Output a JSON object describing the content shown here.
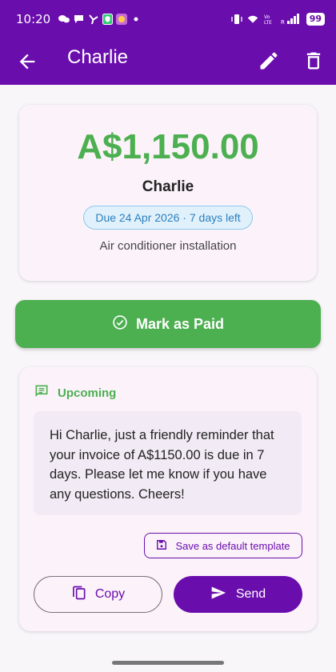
{
  "status_bar": {
    "time": "10:20",
    "battery": "99"
  },
  "app_bar": {
    "title": "Charlie"
  },
  "invoice": {
    "amount": "A$1,150.00",
    "client_name": "Charlie",
    "due_text": "Due 24 Apr 2026 · 7 days left",
    "description": "Air conditioner installation"
  },
  "actions": {
    "mark_paid_label": "Mark as Paid"
  },
  "reminder": {
    "status_label": "Upcoming",
    "message": "Hi Charlie, just a friendly reminder that your invoice of A$1150.00 is due in 7 days. Please let me know if you have any questions. Cheers!",
    "save_template_label": "Save as default template",
    "copy_label": "Copy",
    "send_label": "Send"
  },
  "colors": {
    "primary": "#6a0dad",
    "success": "#4caf50",
    "badge_bg": "#e1f1fb",
    "badge_text": "#2a7fbf"
  },
  "icons": {
    "back": "arrow-left-icon",
    "edit": "pencil-icon",
    "delete": "trash-icon",
    "mark_paid": "check-circle-icon",
    "message": "chat-icon",
    "save": "floppy-disk-icon",
    "copy": "copy-icon",
    "send": "send-icon"
  }
}
